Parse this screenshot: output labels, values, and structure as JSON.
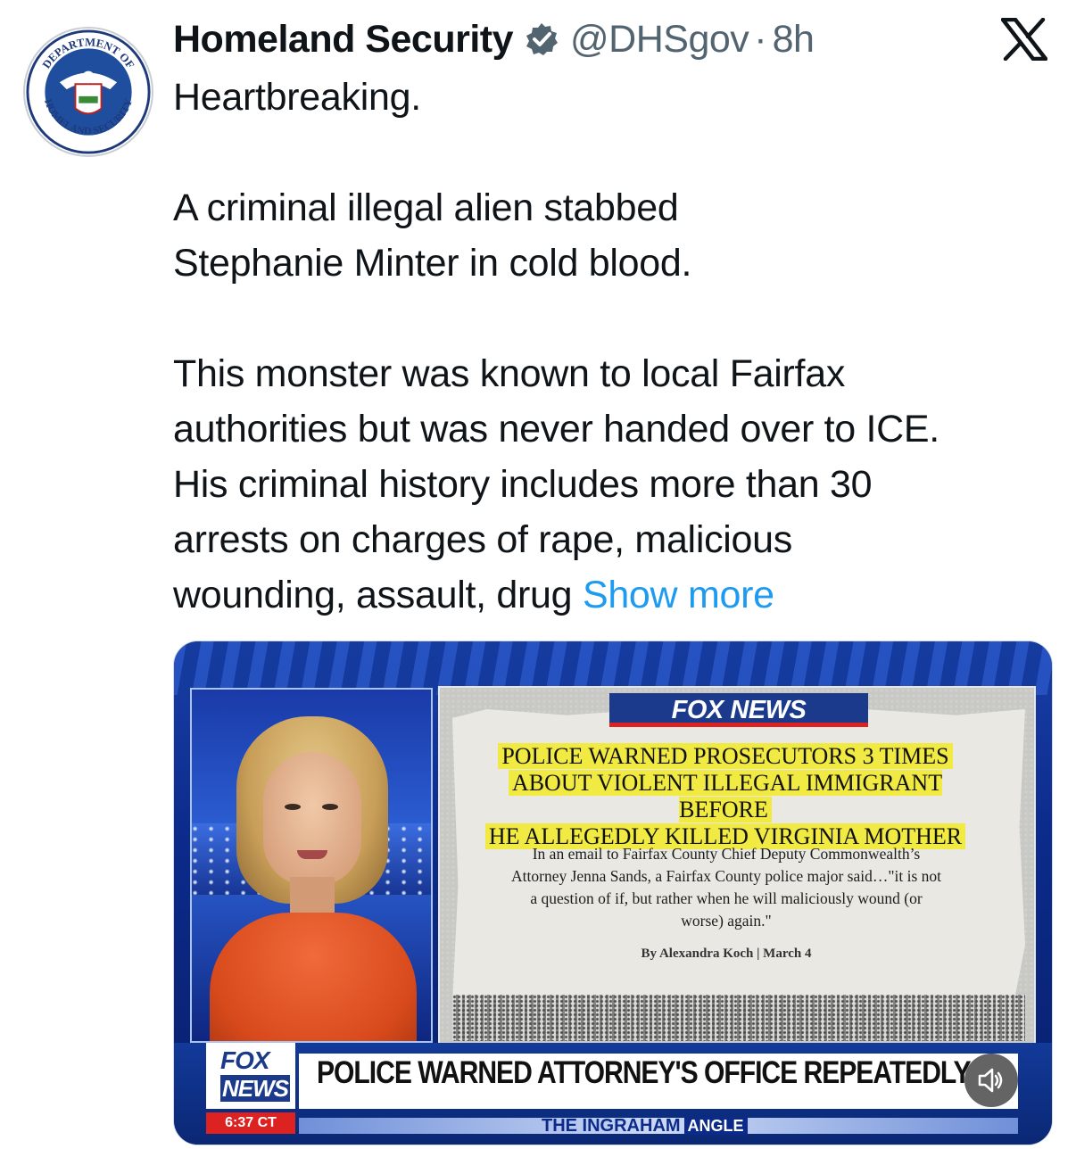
{
  "post": {
    "author_name": "Homeland Security",
    "handle": "@DHSgov",
    "separator": "·",
    "time": "8h",
    "avatar_icon": "dhs-seal-icon",
    "verified_icon": "verified-badge-icon",
    "platform_icon": "x-logo-icon",
    "avatar_text": {
      "top": "DEPARTMENT OF",
      "left": "U.S.",
      "bottom": "HOMELAND SECURITY"
    },
    "paragraphs": [
      "Heartbreaking.",
      "A criminal illegal alien stabbed\nStephanie Minter in cold blood.",
      "This monster was known to local Fairfax\nauthorities but was never handed over to ICE.\nHis criminal history includes more than 30\narrests on charges of rape, malicious\nwounding, assault, drug "
    ],
    "show_more": "Show more",
    "colors": {
      "link": "#1d9bf0",
      "verified": "#536471",
      "muted": "#536471"
    }
  },
  "media": {
    "network_label": "FOX NEWS",
    "headline_lines": [
      "POLICE WARNED PROSECUTORS 3 TIMES",
      "ABOUT VIOLENT ILLEGAL IMMIGRANT BEFORE",
      "HE ALLEGEDLY KILLED VIRGINIA MOTHER"
    ],
    "article_lines": [
      "In an email to Fairfax County Chief Deputy Commonwealth’s",
      "Attorney Jenna Sands, a Fairfax County police major said…\"it is not",
      "a question of if, but rather when he will maliciously wound (or",
      "worse) again.\""
    ],
    "byline": "By Alexandra Koch | March 4",
    "chyron": "POLICE WARNED ATTORNEY'S OFFICE REPEATEDLY",
    "logo_fox": "FOX",
    "logo_news": "NEWS",
    "clock": "6:37 CT",
    "show_name": "THE INGRAHAM",
    "show_name_suffix": "ANGLE",
    "mute_icon": "speaker-muted-icon"
  }
}
